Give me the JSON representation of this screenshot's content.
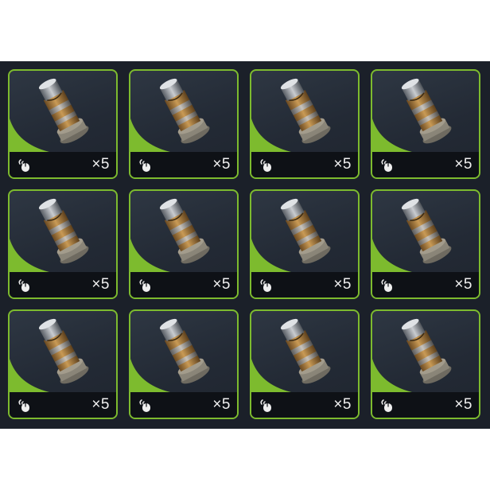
{
  "inventory": {
    "accent_color": "#7dbb2e",
    "slots": [
      {
        "item_icon": "brass-cylinder-icon",
        "action_icon": "mouse-click-icon",
        "quantity": "×5"
      },
      {
        "item_icon": "brass-cylinder-icon",
        "action_icon": "mouse-click-icon",
        "quantity": "×5"
      },
      {
        "item_icon": "brass-cylinder-icon",
        "action_icon": "mouse-click-icon",
        "quantity": "×5"
      },
      {
        "item_icon": "brass-cylinder-icon",
        "action_icon": "mouse-click-icon",
        "quantity": "×5"
      },
      {
        "item_icon": "brass-cylinder-icon",
        "action_icon": "mouse-click-icon",
        "quantity": "×5"
      },
      {
        "item_icon": "brass-cylinder-icon",
        "action_icon": "mouse-click-icon",
        "quantity": "×5"
      },
      {
        "item_icon": "brass-cylinder-icon",
        "action_icon": "mouse-click-icon",
        "quantity": "×5"
      },
      {
        "item_icon": "brass-cylinder-icon",
        "action_icon": "mouse-click-icon",
        "quantity": "×5"
      },
      {
        "item_icon": "brass-cylinder-icon",
        "action_icon": "mouse-click-icon",
        "quantity": "×5"
      },
      {
        "item_icon": "brass-cylinder-icon",
        "action_icon": "mouse-click-icon",
        "quantity": "×5"
      },
      {
        "item_icon": "brass-cylinder-icon",
        "action_icon": "mouse-click-icon",
        "quantity": "×5"
      },
      {
        "item_icon": "brass-cylinder-icon",
        "action_icon": "mouse-click-icon",
        "quantity": "×5"
      }
    ]
  }
}
